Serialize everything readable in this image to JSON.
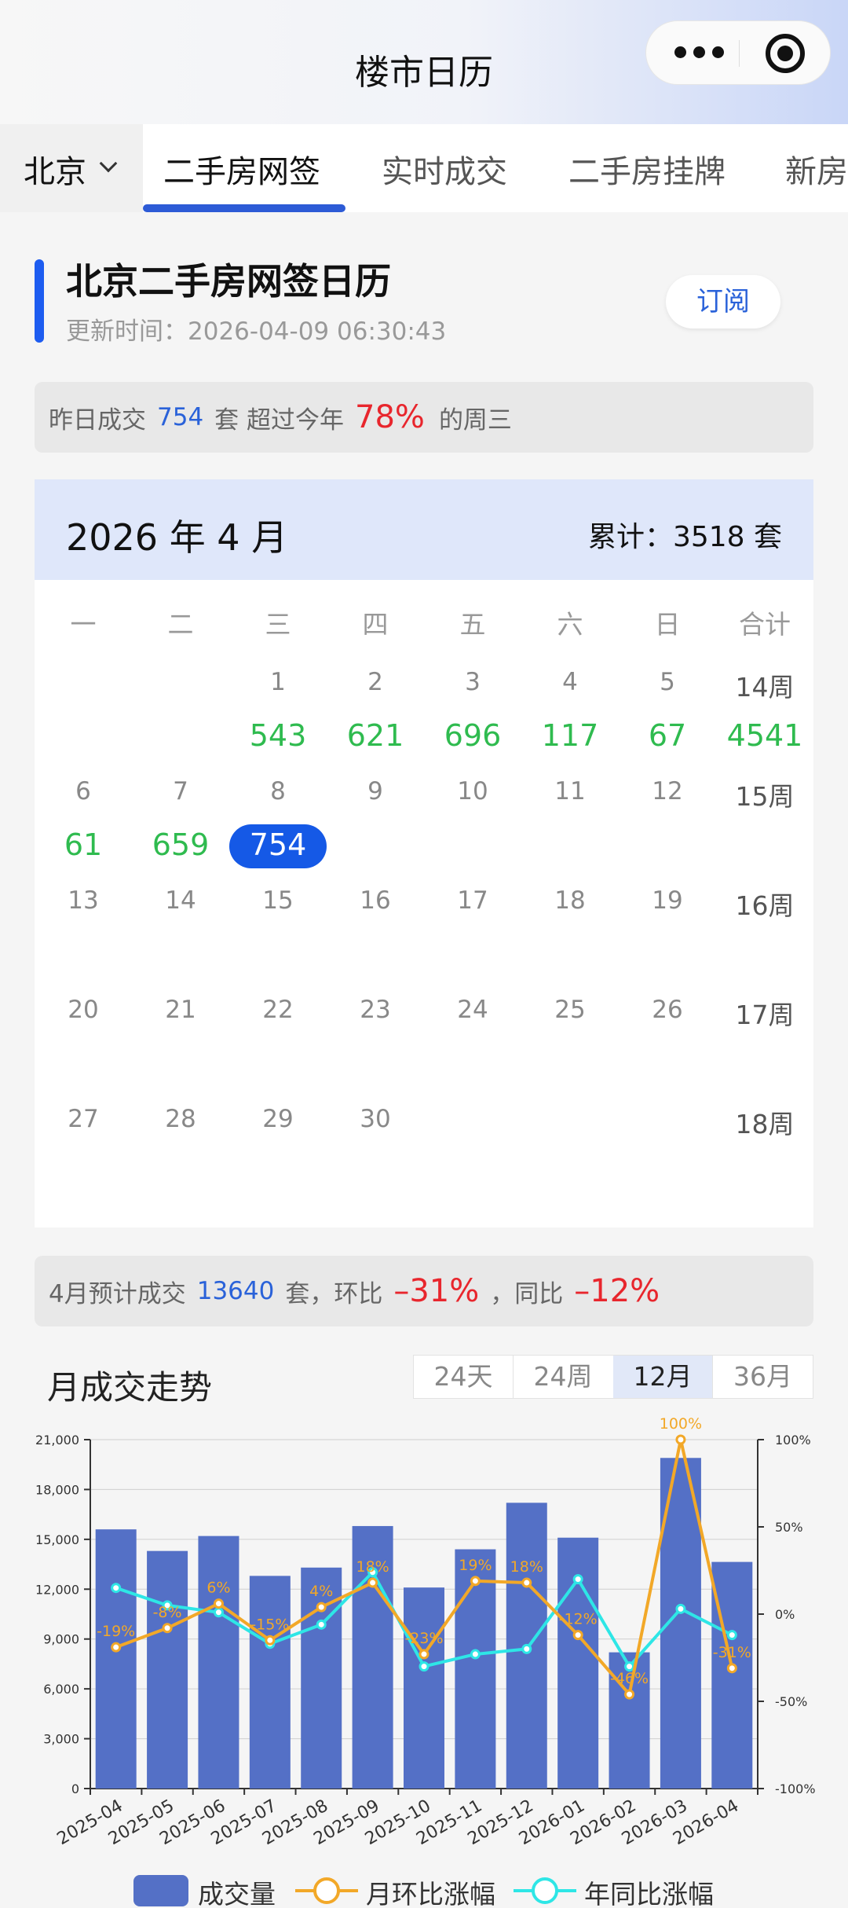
{
  "app": {
    "title": "楼市日历"
  },
  "city_selector": {
    "label": "北京"
  },
  "tabs": [
    {
      "label": "二手房网签",
      "active": true
    },
    {
      "label": "实时成交",
      "active": false
    },
    {
      "label": "二手房挂牌",
      "active": false
    },
    {
      "label": "新房",
      "active": false
    }
  ],
  "header": {
    "title": "北京二手房网签日历",
    "updated_prefix": "更新时间：",
    "updated_at": "2026-04-09 06:30:43",
    "subscribe_label": "订阅"
  },
  "summary": {
    "prefix": "昨日成交",
    "count": "754",
    "unit": "套 超过今年",
    "percent": "78%",
    "suffix": "的周三"
  },
  "calendar": {
    "month_title": "2026 年 4 月",
    "total_label": "累计：3518 套",
    "weekdays": [
      "一",
      "二",
      "三",
      "四",
      "五",
      "六",
      "日",
      "合计"
    ],
    "weeks": [
      {
        "days": [
          "",
          "",
          "1",
          "2",
          "3",
          "4",
          "5"
        ],
        "week_label": "14周",
        "values": [
          "",
          "",
          "543",
          "621",
          "696",
          "117",
          "67"
        ],
        "week_total": "4541"
      },
      {
        "days": [
          "6",
          "7",
          "8",
          "9",
          "10",
          "11",
          "12"
        ],
        "week_label": "15周",
        "values": [
          "61",
          "659",
          "754",
          "",
          "",
          "",
          ""
        ],
        "week_total": ""
      },
      {
        "days": [
          "13",
          "14",
          "15",
          "16",
          "17",
          "18",
          "19"
        ],
        "week_label": "16周",
        "values": [
          "",
          "",
          "",
          "",
          "",
          "",
          ""
        ],
        "week_total": ""
      },
      {
        "days": [
          "20",
          "21",
          "22",
          "23",
          "24",
          "25",
          "26"
        ],
        "week_label": "17周",
        "values": [
          "",
          "",
          "",
          "",
          "",
          "",
          ""
        ],
        "week_total": ""
      },
      {
        "days": [
          "27",
          "28",
          "29",
          "30",
          "",
          "",
          ""
        ],
        "week_label": "18周",
        "values": [
          "",
          "",
          "",
          "",
          "",
          "",
          ""
        ],
        "week_total": ""
      }
    ],
    "selected_value": "754"
  },
  "forecast": {
    "prefix": "4月预计成交",
    "count": "13640",
    "mid": "套，环比",
    "mom": "–31%",
    "sep": "，同比",
    "yoy": "–12%"
  },
  "trend": {
    "title": "月成交走势",
    "ranges": [
      {
        "label": "24天",
        "active": false
      },
      {
        "label": "24周",
        "active": false
      },
      {
        "label": "12月",
        "active": true
      },
      {
        "label": "36月",
        "active": false
      }
    ]
  },
  "chart_data": {
    "type": "bar",
    "categories": [
      "2025-04",
      "2025-05",
      "2025-06",
      "2025-07",
      "2025-08",
      "2025-09",
      "2025-10",
      "2025-11",
      "2025-12",
      "2026-01",
      "2026-02",
      "2026-03",
      "2026-04"
    ],
    "ylim": [
      0,
      21000
    ],
    "y_ticks": [
      "0",
      "3,000",
      "6,000",
      "9,000",
      "12,000",
      "15,000",
      "18,000",
      "21,000"
    ],
    "y2lim": [
      -100,
      100
    ],
    "y2_ticks": [
      "-100%",
      "-50%",
      "0%",
      "50%",
      "100%"
    ],
    "series": [
      {
        "name": "成交量",
        "kind": "bar",
        "color": "#5470c6",
        "values": [
          15600,
          14300,
          15200,
          12800,
          13300,
          15800,
          12100,
          14400,
          17200,
          15100,
          8200,
          19900,
          13640
        ]
      },
      {
        "name": "月环比涨幅",
        "kind": "line",
        "axis": "right",
        "color": "#f2a828",
        "values": [
          -19,
          -8,
          6,
          -15,
          4,
          18,
          -23,
          19,
          18,
          -12,
          -46,
          100,
          -31
        ],
        "labels": [
          "-19%",
          "-8%",
          "6%",
          "-15%",
          "4%",
          "18%",
          "-23%",
          "19%",
          "18%",
          "-12%",
          "-46%",
          "100%",
          "-31%"
        ]
      },
      {
        "name": "年同比涨幅",
        "kind": "line",
        "axis": "right",
        "color": "#2ee6e6",
        "values": [
          15,
          5,
          1,
          -17,
          -6,
          24,
          -30,
          -23,
          -20,
          20,
          -30,
          3,
          -12
        ]
      }
    ],
    "legend": "bottom"
  }
}
